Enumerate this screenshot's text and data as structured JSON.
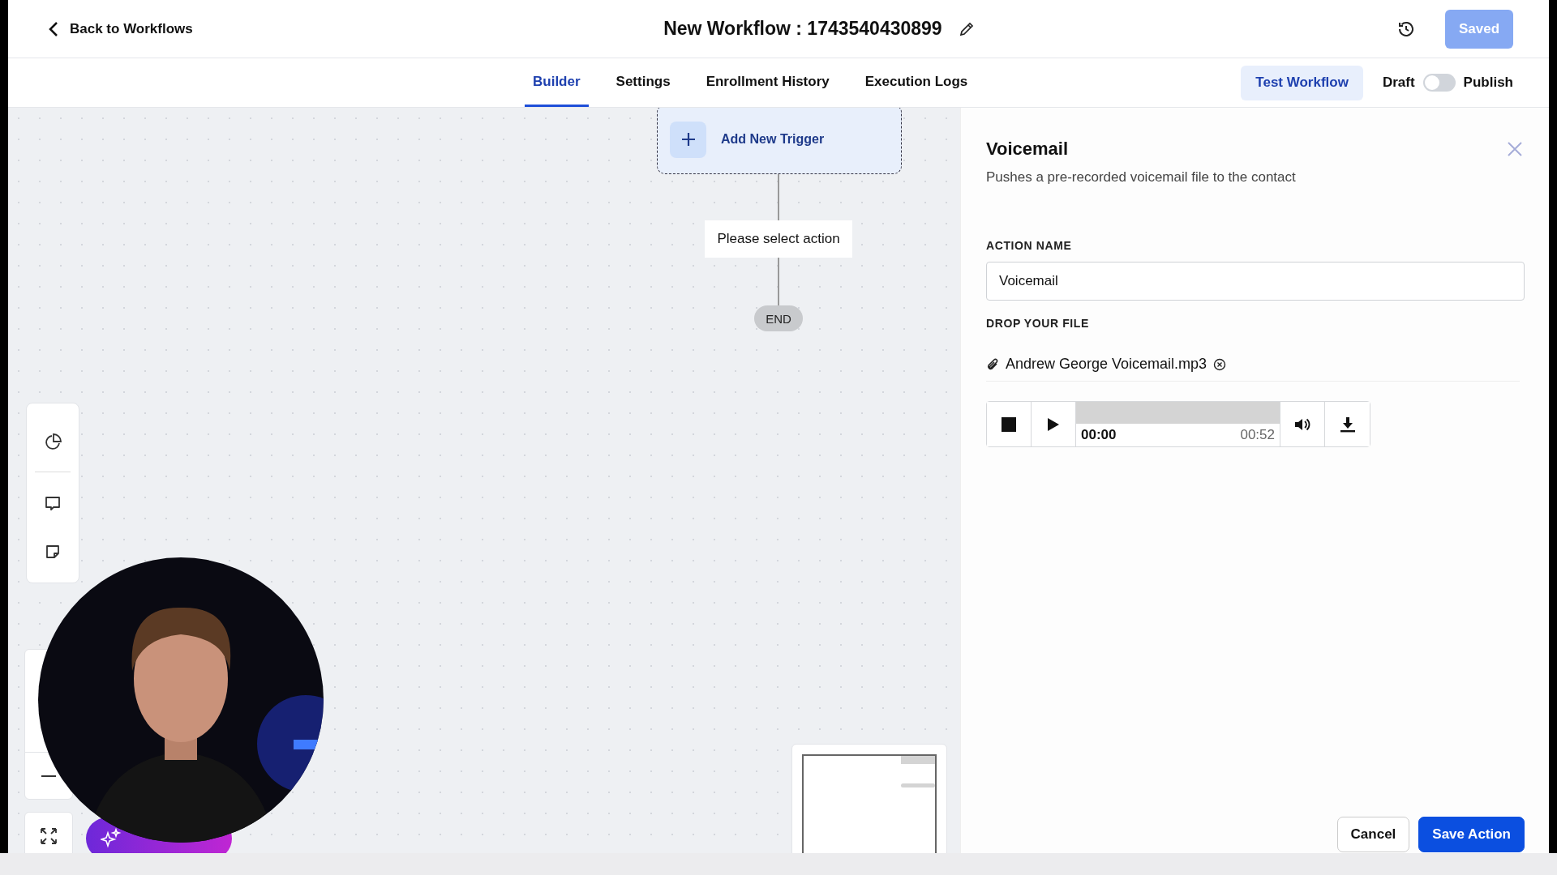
{
  "header": {
    "back_link": "Back to Workflows",
    "title": "New Workflow : 1743540430899",
    "save_button": {
      "label": "Saved",
      "disabled": true
    }
  },
  "tabs": [
    {
      "label": "Builder",
      "selected": true
    },
    {
      "label": "Settings",
      "selected": false
    },
    {
      "label": "Enrollment History",
      "selected": false
    },
    {
      "label": "Execution Logs",
      "selected": false
    }
  ],
  "test_button": "Test Workflow",
  "publish_toggle": {
    "off_label": "Draft",
    "on_label": "Publish",
    "on": false
  },
  "canvas": {
    "trigger": "Add New Trigger",
    "action_placeholder": "Please select action",
    "end": "END"
  },
  "panel": {
    "title": "Voicemail",
    "description": "Pushes a pre-recorded voicemail file to the contact",
    "action_name_label": "ACTION NAME",
    "action_name_value": "Voicemail",
    "file_label": "DROP YOUR FILE",
    "file_name": "Andrew George Voicemail.mp3",
    "player": {
      "elapsed": "00:00",
      "duration": "00:52"
    },
    "buttons": [
      "Cancel",
      "Save Action"
    ]
  }
}
